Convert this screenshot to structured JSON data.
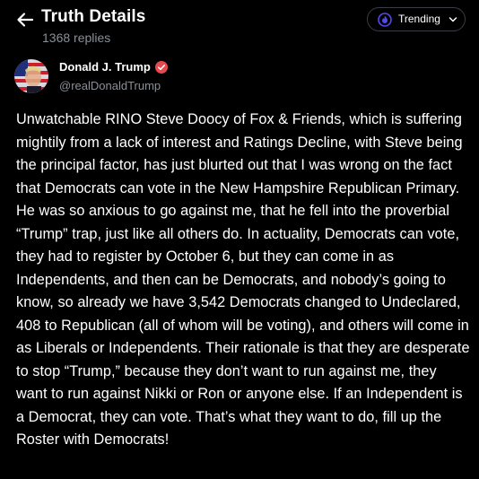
{
  "header": {
    "title": "Truth Details",
    "replies": "1368 replies",
    "trending_label": "Trending"
  },
  "post": {
    "author_name": "Donald J. Trump",
    "author_handle": "@realDonaldTrump",
    "verified": true,
    "text": "Unwatchable RINO Steve Doocy of Fox & Friends, which is suffering mightily from a lack of interest and Ratings Decline, with Steve being the principal factor, has just blurted out that I was wrong on the fact that Democrats can vote in the New Hampshire Republican Primary. He was so anxious to go against me, that he fell into the proverbial “Trump” trap, just like all others do. In actuality, Democrats can vote, they had to register by October 6, but they can come in as Independents, and then can be Democrats, and nobody’s going to know, so already we have 3,542 Democrats changed to Undeclared, 408 to Republican (all of whom will be voting), and others will come in as Liberals or Independents. Their rationale is that they are desperate to stop “Trump,” because they don’t want to run against me, they want to run against Nikki or Ron or anyone else. If an Independent is a Democrat, they can vote. That’s what they want to do, fill up the Roster with Democrats!"
  },
  "icons": {
    "back": "arrow-left-icon",
    "trending": "flame-icon",
    "dropdown": "chevron-down-icon",
    "verified": "verified-badge-icon"
  },
  "colors": {
    "background": "#000000",
    "text": "#ffffff",
    "muted": "#8a8f98",
    "accent": "#5448ee",
    "verified": "#e5484d",
    "button_border": "#3a3d44"
  }
}
